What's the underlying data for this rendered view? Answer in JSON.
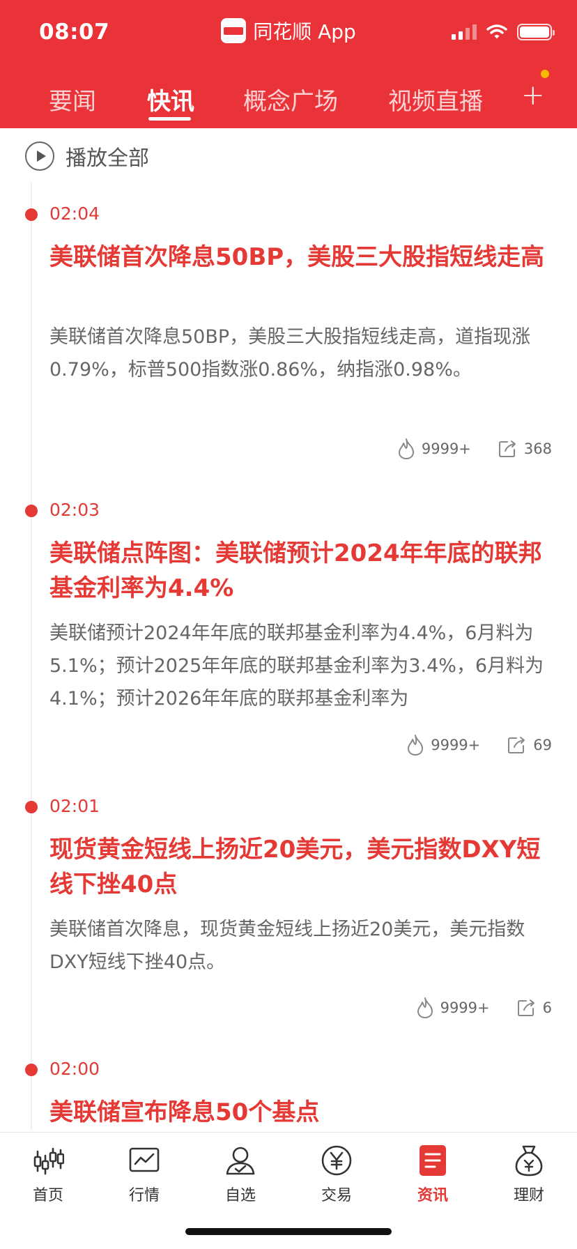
{
  "status_bar": {
    "time": "08:07"
  },
  "app": {
    "title": "同花顺 App"
  },
  "tabs": [
    {
      "label": "要闻",
      "active": false
    },
    {
      "label": "快讯",
      "active": true
    },
    {
      "label": "概念广场",
      "active": false
    },
    {
      "label": "视频直播",
      "active": false
    }
  ],
  "tabs_more": "+",
  "play_all": {
    "label": "播放全部"
  },
  "news": [
    {
      "time": "02:04",
      "title": "美联储首次降息50BP，美股三大股指短线走高",
      "body": "美联储首次降息50BP，美股三大股指短线走高，道指现涨0.79%，标普500指数涨0.86%，纳指涨0.98%。",
      "heat": "9999+",
      "shares": "368"
    },
    {
      "time": "02:03",
      "title": "美联储点阵图：美联储预计2024年年底的联邦基金利率为4.4%",
      "body": "美联储预计2024年年底的联邦基金利率为4.4%，6月料为5.1%；预计2025年年底的联邦基金利率为3.4%，6月料为4.1%；预计2026年年底的联邦基金利率为",
      "heat": "9999+",
      "shares": "69"
    },
    {
      "time": "02:01",
      "title": "现货黄金短线上扬近20美元，美元指数DXY短线下挫40点",
      "body": "美联储首次降息，现货黄金短线上扬近20美元，美元指数DXY短线下挫40点。",
      "heat": "9999+",
      "shares": "6"
    },
    {
      "time": "02:00",
      "title": "美联储宣布降息50个基点"
    }
  ],
  "bottom_nav": [
    {
      "label": "首页",
      "icon": "candlestick-icon",
      "active": false
    },
    {
      "label": "行情",
      "icon": "chart-line-icon",
      "active": false
    },
    {
      "label": "自选",
      "icon": "user-check-icon",
      "active": false
    },
    {
      "label": "交易",
      "icon": "yen-coin-icon",
      "active": false
    },
    {
      "label": "资讯",
      "icon": "news-icon",
      "active": true
    },
    {
      "label": "理财",
      "icon": "money-bag-icon",
      "active": false
    }
  ],
  "colors": {
    "brand": "#ea3338",
    "accent_text": "#e53935",
    "badge_dot": "#f6b800"
  }
}
